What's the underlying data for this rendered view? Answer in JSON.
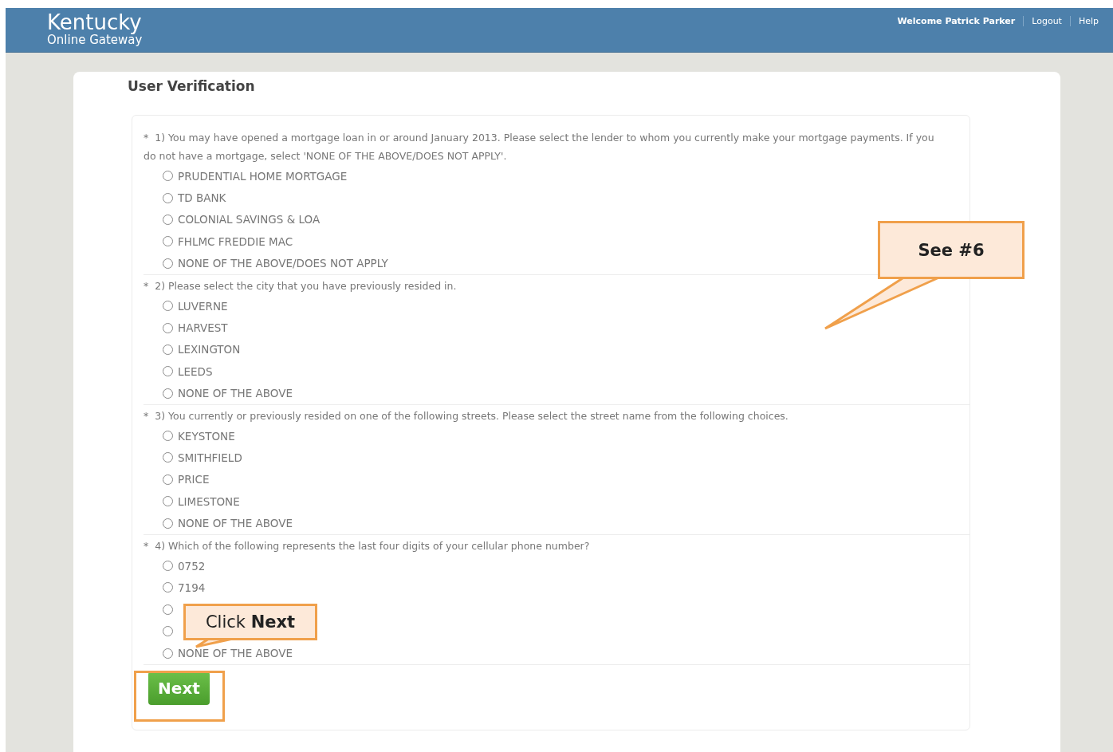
{
  "header": {
    "logo_title": "Kentucky",
    "logo_subtitle": "Online Gateway",
    "links": [
      {
        "label": "Welcome Patrick Parker",
        "kind": "text"
      },
      {
        "label": "Logout",
        "kind": "link"
      },
      {
        "label": "Help",
        "kind": "link"
      }
    ]
  },
  "card": {
    "title": "User Verification",
    "questions": [
      {
        "marker": "*",
        "text": "1) You may have opened a mortgage loan in or around January 2013. Please select the lender to whom you currently make your mortgage payments. If you do not have a mortgage, select 'NONE OF THE ABOVE/DOES NOT APPLY'.",
        "options": [
          {
            "label": "PRUDENTIAL HOME MORTGAGE",
            "selected": false
          },
          {
            "label": "TD BANK",
            "selected": false
          },
          {
            "label": "COLONIAL SAVINGS & LOA",
            "selected": false
          },
          {
            "label": "FHLMC FREDDIE MAC",
            "selected": false
          },
          {
            "label": "NONE OF THE ABOVE/DOES NOT APPLY",
            "selected": false
          }
        ]
      },
      {
        "marker": "*",
        "text": "2) Please select the city that you have previously resided in.",
        "options": [
          {
            "label": "LUVERNE",
            "selected": false
          },
          {
            "label": "HARVEST",
            "selected": false
          },
          {
            "label": "LEXINGTON",
            "selected": false
          },
          {
            "label": "LEEDS",
            "selected": false
          },
          {
            "label": "NONE OF THE ABOVE",
            "selected": false
          }
        ]
      },
      {
        "marker": "*",
        "text": "3) You currently or previously resided on one of the following streets. Please select the street name from the following choices.",
        "options": [
          {
            "label": "KEYSTONE",
            "selected": false
          },
          {
            "label": "SMITHFIELD",
            "selected": false
          },
          {
            "label": "PRICE",
            "selected": false
          },
          {
            "label": "LIMESTONE",
            "selected": false
          },
          {
            "label": "NONE OF THE ABOVE",
            "selected": false
          }
        ]
      },
      {
        "marker": "*",
        "text": "4) Which of the following represents the last four digits of your cellular phone number?",
        "options": [
          {
            "label": "0752",
            "selected": false
          },
          {
            "label": "7194",
            "selected": false
          },
          {
            "selected": false
          },
          {
            "selected": false
          },
          {
            "label": "NONE OF THE ABOVE",
            "selected": false
          }
        ]
      }
    ],
    "next_button": "Next"
  },
  "annotations": [
    {
      "kind": "callout",
      "text": "See #6"
    },
    {
      "kind": "callout",
      "text": "Click **Next**"
    }
  ]
}
